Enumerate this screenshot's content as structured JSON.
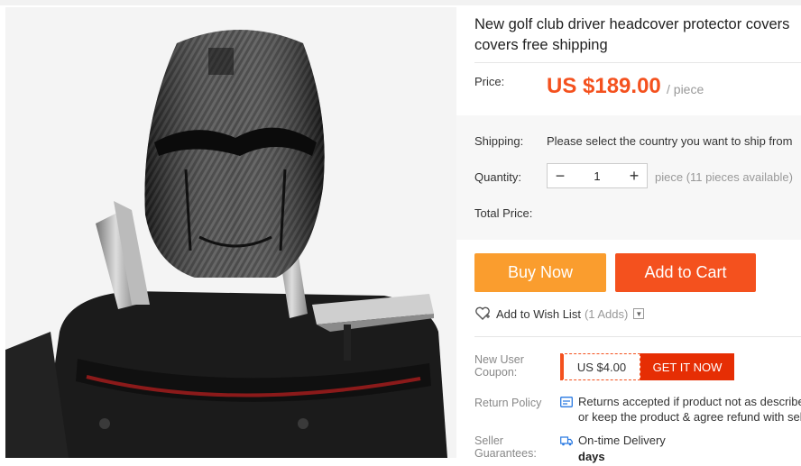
{
  "product": {
    "title": "New golf club driver headcover protector covers covers free shipping",
    "image_alt": "Carbon-fiber helmet-style golf club driver headcover on golf bag"
  },
  "price": {
    "label": "Price:",
    "value": "US $189.00",
    "unit": "/ piece",
    "accent_color": "#f4511e"
  },
  "shipping": {
    "label": "Shipping:",
    "text": "Please select the country you want to ship from"
  },
  "quantity": {
    "label": "Quantity:",
    "value": "1",
    "minus": "−",
    "plus": "+",
    "availability": "piece (11 pieces available)"
  },
  "total": {
    "label": "Total Price:"
  },
  "actions": {
    "buy_now": "Buy Now",
    "add_to_cart": "Add to Cart",
    "buy_color": "#fa9d2e",
    "cart_color": "#f4511e"
  },
  "wishlist": {
    "label": "Add to Wish List",
    "count": "(1 Adds)",
    "icon": "heart-plus-icon"
  },
  "coupon": {
    "label_line1": "New User",
    "label_line2": "Coupon:",
    "value": "US $4.00",
    "button": "GET IT NOW"
  },
  "return_policy": {
    "label": "Return Policy",
    "line1": "Returns accepted if product not as described",
    "line2": "or keep the product & agree refund with seller"
  },
  "seller_guarantees": {
    "label_line1": "Seller",
    "label_line2": "Guarantees:",
    "line1": "On-time Delivery",
    "line2": "days"
  }
}
